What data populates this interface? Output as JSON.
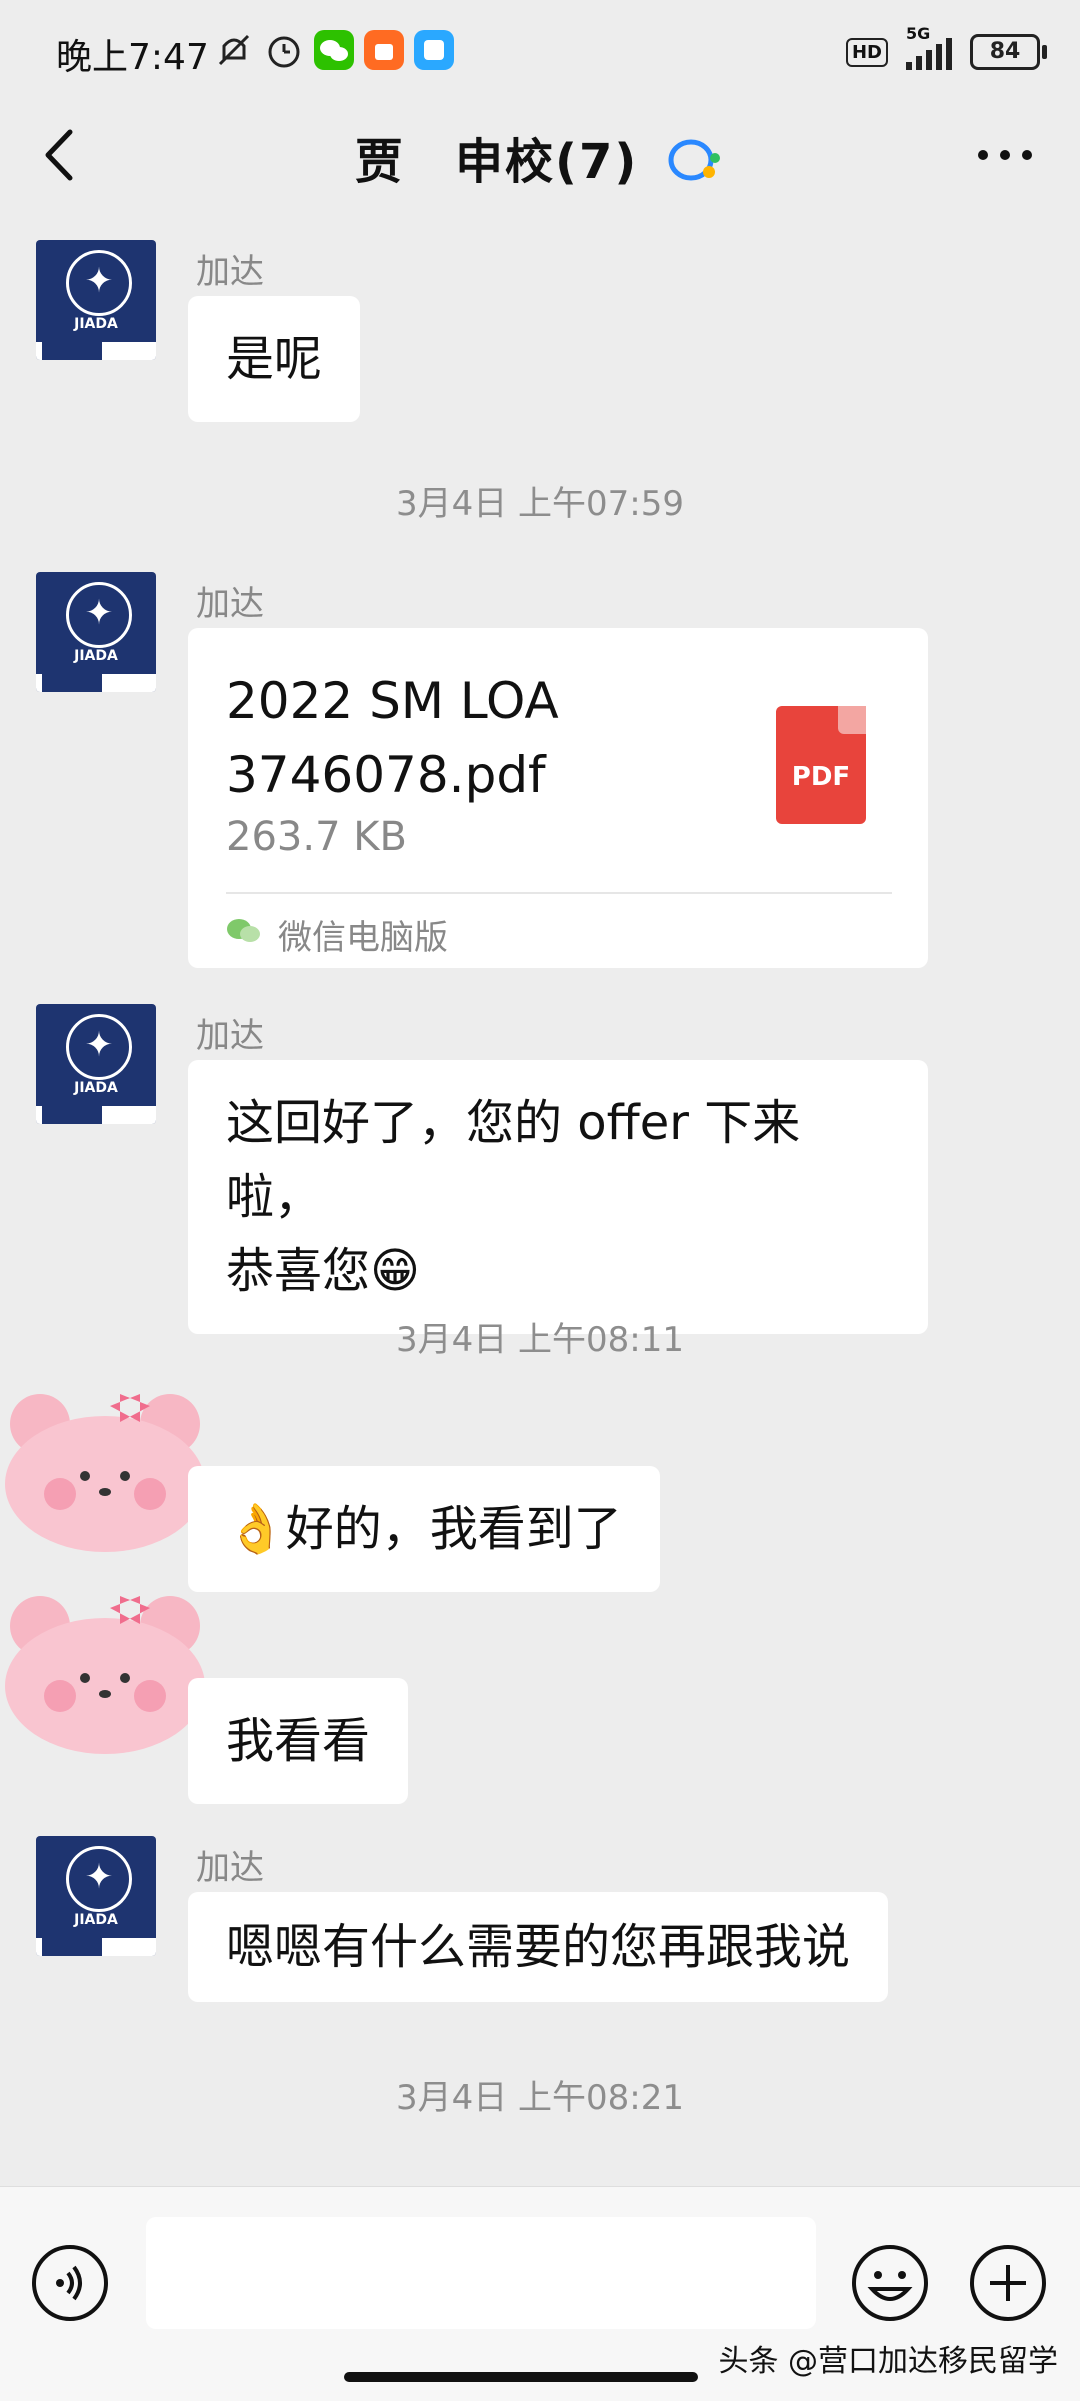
{
  "status_bar": {
    "time": "晚上7:47",
    "hd_label": "HD",
    "network": "5G",
    "battery": "84"
  },
  "header": {
    "title": "贾　申校(7)",
    "back_icon": "chevron-left-icon",
    "more_icon": "more-horizontal-icon"
  },
  "messages": [
    {
      "sender": "加达",
      "text": "是呢"
    },
    {
      "sender": "加达",
      "file": {
        "name_line1": "2022 SM LOA",
        "name_line2": "3746078.pdf",
        "size": "263.7 KB",
        "source": "微信电脑版",
        "type_label": "PDF"
      }
    },
    {
      "sender": "加达",
      "line1": "这回好了，您的 offer 下来啦，",
      "line2": "恭喜您😁"
    },
    {
      "text": "👌好的，我看到了"
    },
    {
      "text": "我看看"
    },
    {
      "sender": "加达",
      "text": "嗯嗯有什么需要的您再跟我说"
    }
  ],
  "timestamps": [
    "3月4日 上午07:59",
    "3月4日 上午08:11",
    "3月4日 上午08:21"
  ],
  "avatar_brand": "JIADA",
  "watermark": "头条 @营口加达移民留学",
  "colors": {
    "background": "#ededed",
    "bubble": "#ffffff",
    "avatar_navy": "#1e3470",
    "pdf_red": "#e8443c"
  }
}
